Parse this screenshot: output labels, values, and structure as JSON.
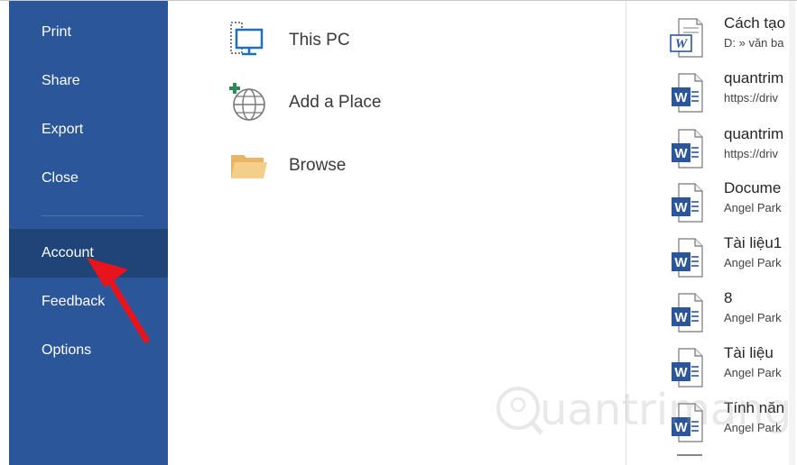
{
  "sidebar": {
    "items": [
      {
        "label": "Print"
      },
      {
        "label": "Share"
      },
      {
        "label": "Export"
      },
      {
        "label": "Close"
      },
      {
        "label": "Account",
        "selected": true
      },
      {
        "label": "Feedback"
      },
      {
        "label": "Options"
      }
    ]
  },
  "locations": [
    {
      "label": "This PC",
      "icon": "computer-icon"
    },
    {
      "label": "Add a Place",
      "icon": "add-place-globe-icon"
    },
    {
      "label": "Browse",
      "icon": "folder-icon"
    }
  ],
  "recent": [
    {
      "name": "Cách tạo",
      "path": "D: » văn ba",
      "icon": "word-legacy-doc-icon"
    },
    {
      "name": "quantrim",
      "path": "https://driv",
      "icon": "word-doc-icon"
    },
    {
      "name": "quantrim",
      "path": "https://driv",
      "icon": "word-doc-icon"
    },
    {
      "name": "Docume",
      "path": "Angel Park",
      "icon": "word-doc-icon"
    },
    {
      "name": "Tài liệu1",
      "path": "Angel Park",
      "icon": "word-doc-icon"
    },
    {
      "name": "8",
      "path": "Angel Park",
      "icon": "word-doc-icon"
    },
    {
      "name": "Tài liệu",
      "path": "Angel Park",
      "icon": "word-doc-icon"
    },
    {
      "name": "Tính năn",
      "path": "Angel Park",
      "icon": "word-doc-icon"
    }
  ],
  "watermark": {
    "text": "uantrimang"
  },
  "colors": {
    "sidebar": "#2b579a",
    "sidebar_selected": "#1f4478",
    "annotation_arrow": "#e8141b",
    "word_blue": "#2b579a"
  }
}
